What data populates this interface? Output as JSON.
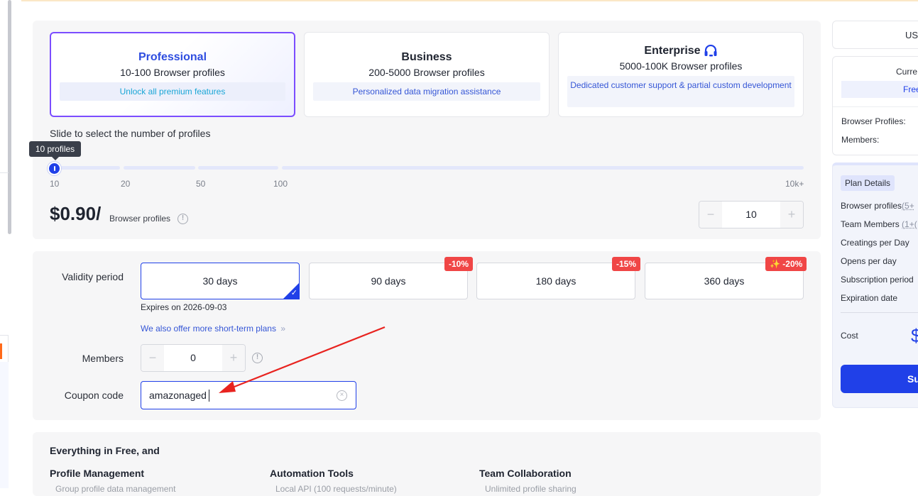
{
  "plans": [
    {
      "title": "Professional",
      "subtitle": "10-100 Browser profiles",
      "note": "Unlock all premium features",
      "selected": true
    },
    {
      "title": "Business",
      "subtitle": "200-5000 Browser profiles",
      "note": "Personalized data migration assistance",
      "selected": false
    },
    {
      "title": "Enterprise",
      "subtitle": "5000-100K Browser profiles",
      "note": "Dedicated customer support & partial custom development",
      "selected": false,
      "icon": "headset-icon"
    }
  ],
  "slider": {
    "label": "Slide to select the number of profiles",
    "tooltip": "10 profiles",
    "value": 10,
    "ticks": [
      "10",
      "20",
      "50",
      "100",
      "10k+"
    ]
  },
  "pricing": {
    "price": "$0.90/",
    "unit": "Browser profiles",
    "profiles_stepper": {
      "value": "10",
      "minus": "−",
      "plus": "+"
    }
  },
  "validity": {
    "label": "Validity period",
    "options": [
      {
        "label": "30 days",
        "badge": "",
        "selected": true
      },
      {
        "label": "90 days",
        "badge": "-10%",
        "selected": false
      },
      {
        "label": "180 days",
        "badge": "-15%",
        "selected": false
      },
      {
        "label": "360 days",
        "badge": "✨ -20%",
        "selected": false
      }
    ],
    "expires": "Expires on 2026-09-03",
    "short_term_link": "We also offer more short-term plans",
    "link_chevron": "»"
  },
  "members": {
    "label": "Members",
    "value": "0",
    "minus": "−",
    "plus": "+"
  },
  "coupon": {
    "label": "Coupon code",
    "value": "amazonaged",
    "clear": "×"
  },
  "features": {
    "heading": "Everything in Free, and",
    "columns": [
      {
        "title": "Profile Management",
        "item": "Group profile data management"
      },
      {
        "title": "Automation Tools",
        "item": "Local API (100 requests/minute)"
      },
      {
        "title": "Team Collaboration",
        "item": "Unlimited profile sharing"
      }
    ]
  },
  "summary": {
    "currency": "US",
    "current_label": "Curre",
    "current_plan": "Free",
    "browser_profiles_label": "Browser Profiles:",
    "members_label": "Members:",
    "plan_details": "Plan Details",
    "rows": [
      {
        "label": "Browser profiles",
        "extra": "(5+"
      },
      {
        "label": "Team Members",
        "extra": "(1+("
      },
      {
        "label": "Creatings per Day",
        "extra": ""
      },
      {
        "label": "Opens per day",
        "extra": ""
      },
      {
        "label": "Subscription period",
        "extra": ""
      },
      {
        "label": "Expiration date",
        "extra": ""
      }
    ],
    "cost_label": "Cost",
    "cost_symbol": "$",
    "subscribe": "Subs"
  },
  "annotation": {
    "arrow_color": "#e8231f"
  }
}
